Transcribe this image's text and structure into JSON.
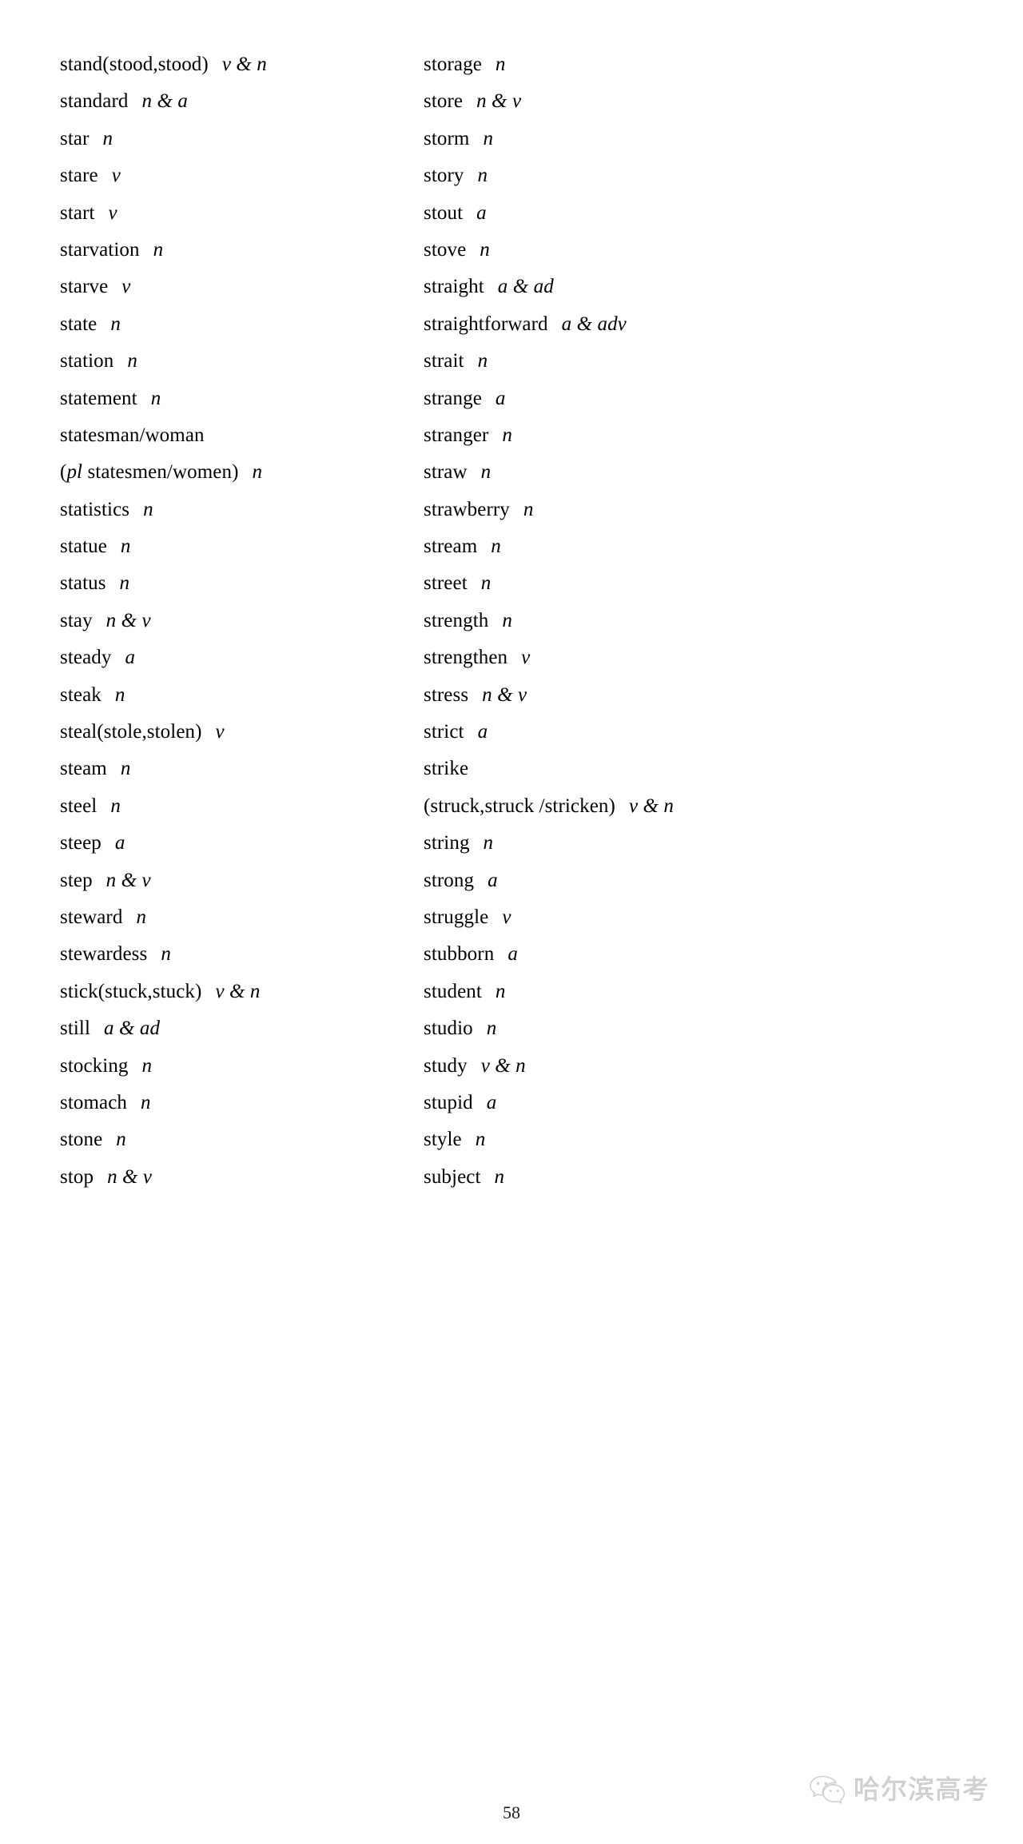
{
  "document": {
    "page_number": "58",
    "watermark": {
      "icon": "wechat-icon",
      "text": "哈尔滨高考",
      "color": "#cfcfcf"
    }
  },
  "columns": {
    "left": [
      {
        "word": "stand(stood,stood)",
        "pos": "v & n"
      },
      {
        "word": "standard",
        "pos": "n & a"
      },
      {
        "word": "star",
        "pos": "n"
      },
      {
        "word": "stare",
        "pos": "v"
      },
      {
        "word": "start",
        "pos": "v"
      },
      {
        "word": "starvation",
        "pos": "n"
      },
      {
        "word": "starve",
        "pos": "v"
      },
      {
        "word": "state",
        "pos": "n"
      },
      {
        "word": "station",
        "pos": "n"
      },
      {
        "word": "statement",
        "pos": "n"
      },
      {
        "word": "statesman/woman",
        "pos": ""
      },
      {
        "word": "(pl statesmen/women)",
        "pos": "n",
        "italic_prefix": "pl",
        "plain_suffix": " statesmen/women)",
        "leading_paren": "("
      },
      {
        "word": "statistics",
        "pos": "n"
      },
      {
        "word": "statue",
        "pos": "n"
      },
      {
        "word": "status",
        "pos": "n"
      },
      {
        "word": "stay",
        "pos": "n & v"
      },
      {
        "word": "steady",
        "pos": "a"
      },
      {
        "word": "steak",
        "pos": "n"
      },
      {
        "word": "steal(stole,stolen)",
        "pos": "v"
      },
      {
        "word": "steam",
        "pos": "n"
      },
      {
        "word": "steel",
        "pos": "n"
      },
      {
        "word": "steep",
        "pos": "a"
      },
      {
        "word": "step",
        "pos": "n & v"
      },
      {
        "word": "steward",
        "pos": "n"
      },
      {
        "word": "stewardess",
        "pos": "n"
      },
      {
        "word": "stick(stuck,stuck)",
        "pos": "v & n"
      },
      {
        "word": "still",
        "pos": "a & ad"
      },
      {
        "word": "stocking",
        "pos": "n"
      },
      {
        "word": "stomach",
        "pos": "n"
      },
      {
        "word": "stone",
        "pos": "n"
      },
      {
        "word": "stop",
        "pos": "n & v"
      }
    ],
    "right": [
      {
        "word": "storage",
        "pos": "n"
      },
      {
        "word": "store",
        "pos": "n & v"
      },
      {
        "word": "storm",
        "pos": "n"
      },
      {
        "word": "story",
        "pos": "n"
      },
      {
        "word": "stout",
        "pos": "a"
      },
      {
        "word": "stove",
        "pos": "n"
      },
      {
        "word": "straight",
        "pos": "a & ad"
      },
      {
        "word": "straightforward",
        "pos": "a & adv"
      },
      {
        "word": "strait",
        "pos": "n"
      },
      {
        "word": "strange",
        "pos": "a"
      },
      {
        "word": "stranger",
        "pos": "n"
      },
      {
        "word": "straw",
        "pos": "n"
      },
      {
        "word": "strawberry",
        "pos": "n"
      },
      {
        "word": "stream",
        "pos": "n"
      },
      {
        "word": "street",
        "pos": "n"
      },
      {
        "word": "strength",
        "pos": "n"
      },
      {
        "word": "strengthen",
        "pos": "v"
      },
      {
        "word": "stress",
        "pos": "n & v"
      },
      {
        "word": "strict",
        "pos": "a"
      },
      {
        "word": "strike",
        "pos": ""
      },
      {
        "word": "(struck,struck /stricken)",
        "pos": "v & n"
      },
      {
        "word": "string",
        "pos": "n"
      },
      {
        "word": "strong",
        "pos": "a"
      },
      {
        "word": "struggle",
        "pos": "v"
      },
      {
        "word": "stubborn",
        "pos": "a"
      },
      {
        "word": "student",
        "pos": "n"
      },
      {
        "word": "studio",
        "pos": "n"
      },
      {
        "word": "study",
        "pos": "v & n"
      },
      {
        "word": "stupid",
        "pos": "a"
      },
      {
        "word": "style",
        "pos": "n"
      },
      {
        "word": "subject",
        "pos": "n"
      }
    ]
  }
}
